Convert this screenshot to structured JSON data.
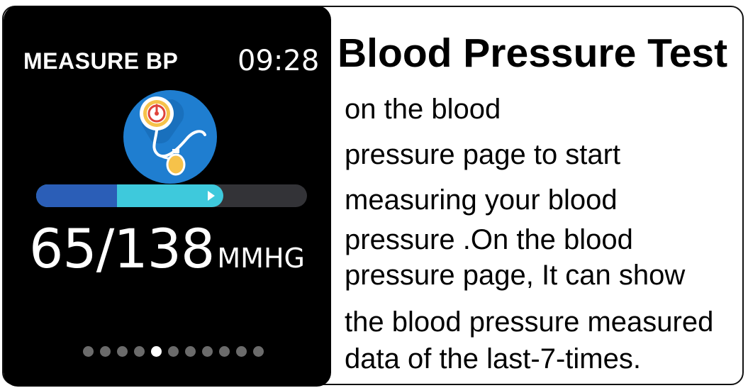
{
  "watch": {
    "title": "MEASURE BP",
    "time": "09:28",
    "icon": "blood-pressure-gauge-icon",
    "progress": 0.69,
    "reading_value": "65/138",
    "reading_unit": "MMHG",
    "page_count": 11,
    "active_page": 5,
    "colors": {
      "background": "#000000",
      "progress_track": "#333337",
      "progress_start": "#2b5eb7",
      "progress_end": "#3ec9dc",
      "icon_circle": "#1f7ed0"
    }
  },
  "panel": {
    "heading": "Blood Pressure Test",
    "lines": [
      "on the blood",
      "pressure page to start",
      "measuring your blood",
      "pressure .On the blood",
      "pressure page, It can show",
      "the blood pressure measured",
      "data of the last-7-times."
    ]
  }
}
